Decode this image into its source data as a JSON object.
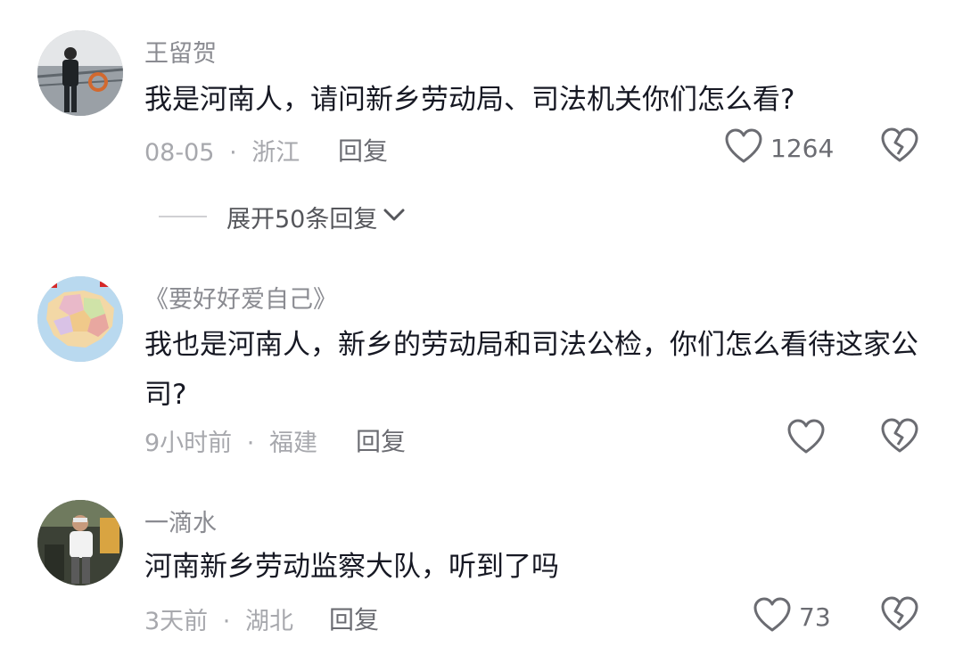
{
  "comments": [
    {
      "username": "王留贺",
      "content": "我是河南人，请问新乡劳动局、司法机关你们怎么看?",
      "time": "08-05",
      "location": "浙江",
      "reply_label": "回复",
      "like_count": "1264",
      "expand_replies": "展开50条回复"
    },
    {
      "username": "《要好好爱自己》",
      "content": "我也是河南人，新乡的劳动局和司法公检，你们怎么看待这家公司?",
      "time": "9小时前",
      "location": "福建",
      "reply_label": "回复",
      "like_count": ""
    },
    {
      "username": "一滴水",
      "content": "河南新乡劳动监察大队，听到了吗",
      "time": "3天前",
      "location": "湖北",
      "reply_label": "回复",
      "like_count": "73"
    }
  ],
  "meta_separator": "·",
  "icons": {
    "like": "heart-outline-icon",
    "dislike": "broken-heart-outline-icon",
    "expand": "chevron-down-icon"
  },
  "colors": {
    "text_primary": "#161823",
    "text_secondary": "#8a8b91",
    "icon": "#6b6c72"
  }
}
